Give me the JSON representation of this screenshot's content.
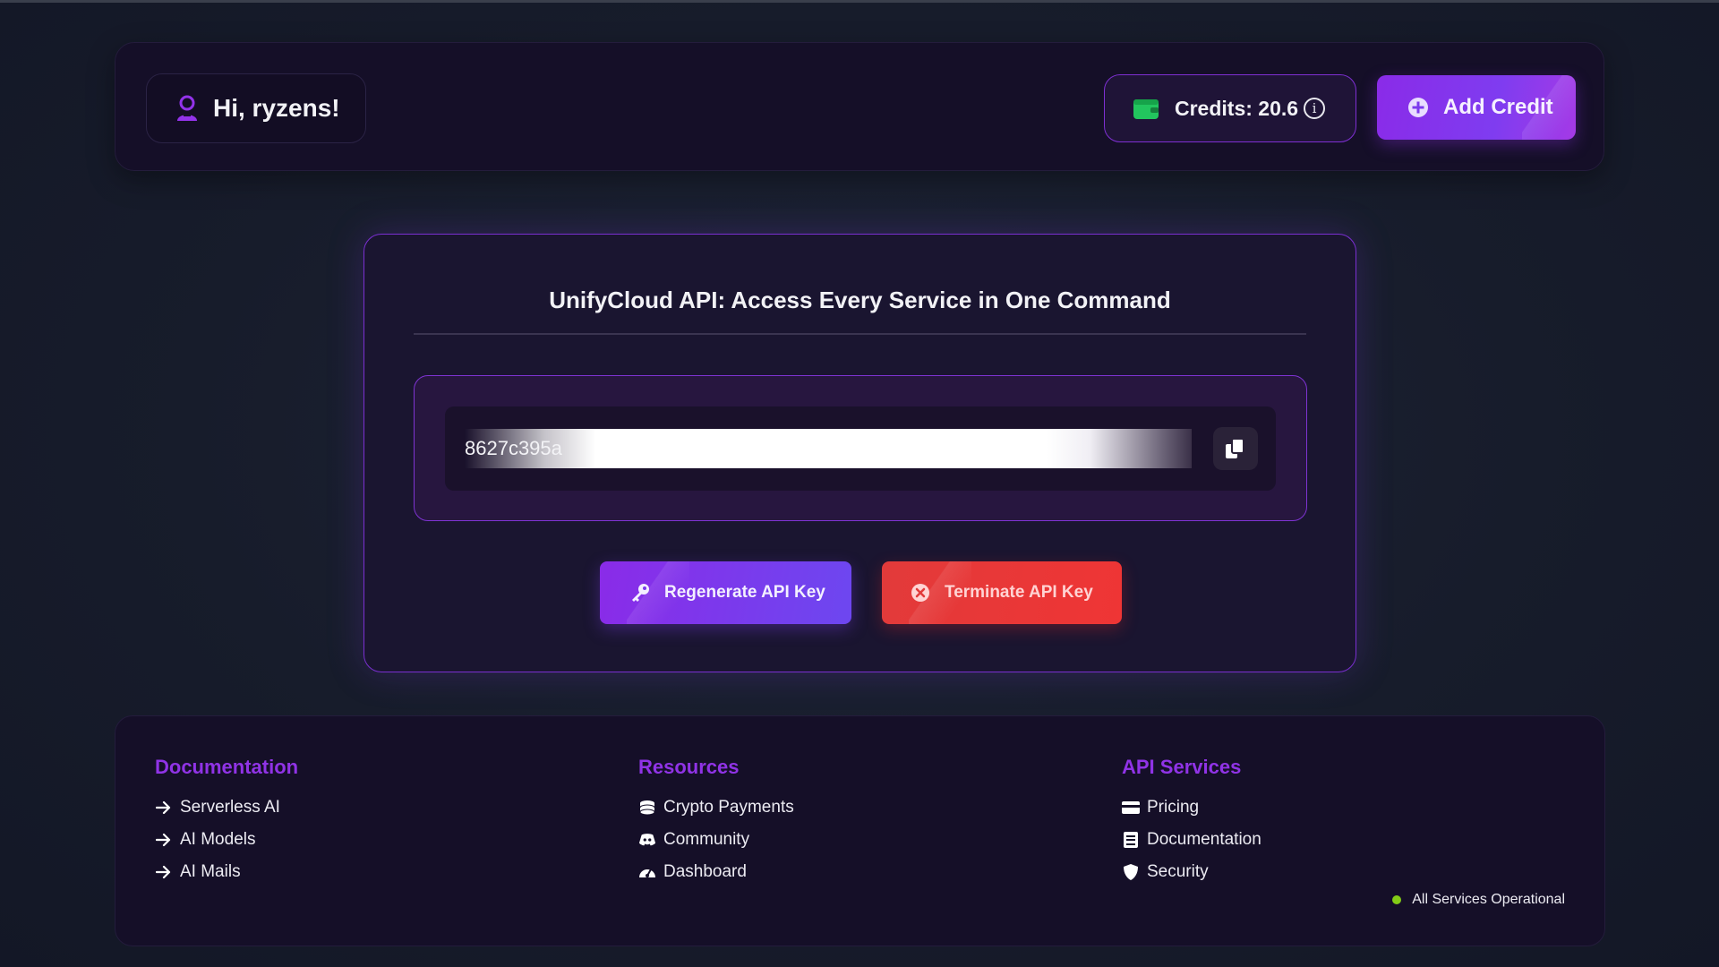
{
  "header": {
    "greeting": "Hi, ryzens!",
    "credits_label": "Credits: 20.6",
    "add_credit_label": "Add Credit"
  },
  "card": {
    "title": "UnifyCloud API: Access Every Service in One Command",
    "api_key_visible": "8627c395a",
    "regenerate_label": "Regenerate API Key",
    "terminate_label": "Terminate API Key"
  },
  "footer": {
    "documentation": {
      "title": "Documentation",
      "items": [
        "Serverless AI",
        "AI Models",
        "AI Mails"
      ]
    },
    "resources": {
      "title": "Resources",
      "items": [
        "Crypto Payments",
        "Community",
        "Dashboard"
      ]
    },
    "api_services": {
      "title": "API Services",
      "items": [
        "Pricing",
        "Documentation",
        "Security"
      ]
    },
    "status_text": "All Services Operational"
  },
  "colors": {
    "accent_purple": "#8a2be8",
    "danger_red": "#e23a3a",
    "status_green": "#84cc16",
    "wallet_green": "#22c55e"
  },
  "icons": {
    "user": "user-icon",
    "wallet": "wallet-icon",
    "info": "info-icon",
    "add": "plus-circle-icon",
    "copy": "copy-icon",
    "key": "key-icon",
    "terminate": "x-circle-icon"
  }
}
